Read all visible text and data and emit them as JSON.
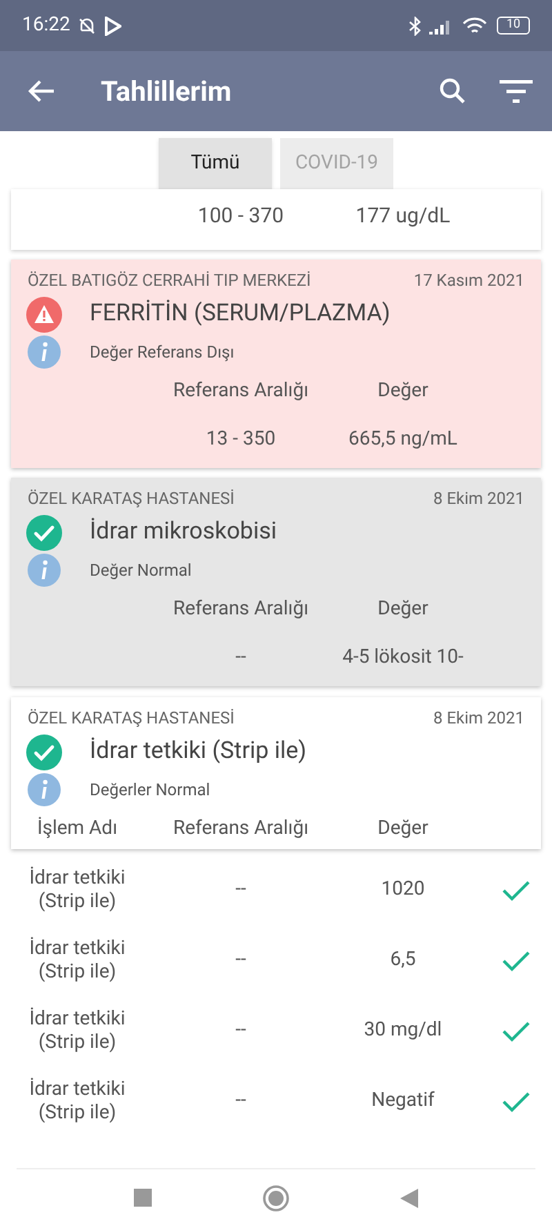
{
  "status_bar": {
    "time": "16:22",
    "battery": "10"
  },
  "app_bar": {
    "title": "Tahlillerim"
  },
  "filters": [
    {
      "label": "Tümü",
      "selected": true
    },
    {
      "label": "COVID-19",
      "selected": false
    }
  ],
  "partial_card": {
    "reference": "100 - 370",
    "value": "177 ug/dL"
  },
  "cards": [
    {
      "kind": "out_of_range",
      "institution": "ÖZEL BATIGÖZ CERRAHİ TIP MERKEZİ",
      "date": "17 Kasım 2021",
      "test": "FERRİTİN (SERUM/PLAZMA)",
      "note": "Değer Referans Dışı",
      "columns": [
        "Referans Aralığı",
        "Değer"
      ],
      "reference": "13 - 350",
      "value": "665,5 ng/mL"
    },
    {
      "kind": "normal",
      "shaded": true,
      "institution": "ÖZEL KARATAŞ HASTANESİ",
      "date": "8 Ekim 2021",
      "test": "İdrar mikroskobisi",
      "note": "Değer Normal",
      "columns": [
        "Referans Aralığı",
        "Değer"
      ],
      "reference": "--",
      "value": "4-5 lökosit 10-"
    },
    {
      "kind": "normal",
      "shaded": false,
      "institution": "ÖZEL KARATAŞ HASTANESİ",
      "date": "8 Ekim 2021",
      "test": "İdrar tetkiki (Strip ile)",
      "note": "Değerler Normal",
      "columns": [
        "İşlem Adı",
        "Referans Aralığı",
        "Değer"
      ]
    }
  ],
  "rows": [
    {
      "name": "İdrar tetkiki (Strip ile)",
      "reference": "--",
      "value": "1020",
      "normal": true
    },
    {
      "name": "İdrar tetkiki (Strip ile)",
      "reference": "--",
      "value": "6,5",
      "normal": true
    },
    {
      "name": "İdrar tetkiki (Strip ile)",
      "reference": "--",
      "value": "30 mg/dl",
      "normal": true
    },
    {
      "name": "İdrar tetkiki (Strip ile)",
      "reference": "--",
      "value": "Negatif",
      "normal": true
    }
  ]
}
